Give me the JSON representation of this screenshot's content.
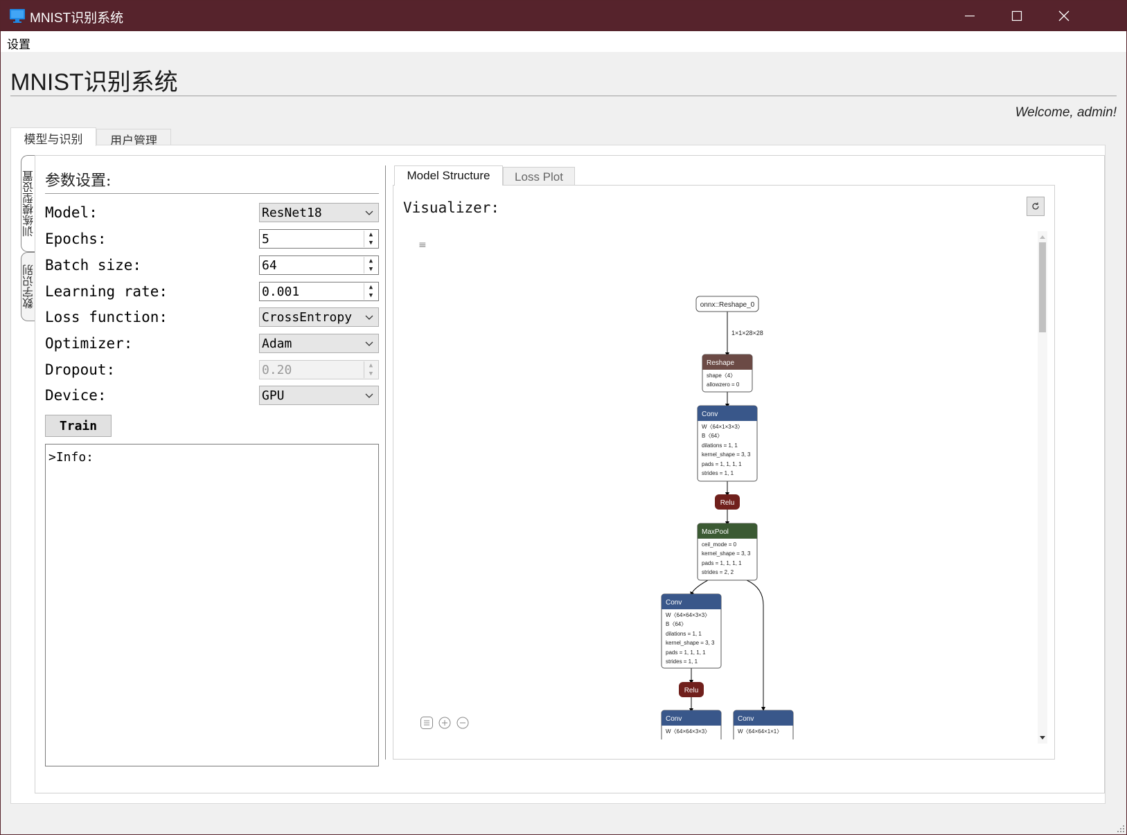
{
  "window": {
    "title": "MNIST识别系统"
  },
  "menu": {
    "settings": "设置"
  },
  "header": {
    "app_title": "MNIST识别系统",
    "welcome": "Welcome, admin!"
  },
  "main_tabs": [
    {
      "label": "模型与识别"
    },
    {
      "label": "用户管理"
    }
  ],
  "side_tabs": [
    {
      "label": "训练模型设置"
    },
    {
      "label": "数字识别"
    }
  ],
  "params": {
    "title": "参数设置:",
    "model": {
      "label": "Model:",
      "value": "ResNet18"
    },
    "epochs": {
      "label": "Epochs:",
      "value": "5"
    },
    "batch_size": {
      "label": "Batch size:",
      "value": "64"
    },
    "learning_rate": {
      "label": "Learning rate:",
      "value": "0.001"
    },
    "loss_function": {
      "label": "Loss function:",
      "value": "CrossEntropy"
    },
    "optimizer": {
      "label": "Optimizer:",
      "value": "Adam"
    },
    "dropout": {
      "label": "Dropout:",
      "value": "0.20"
    },
    "device": {
      "label": "Device:",
      "value": "GPU"
    },
    "train_button": "Train",
    "info_text": ">Info:"
  },
  "right_tabs": [
    {
      "label": "Model Structure"
    },
    {
      "label": "Loss Plot"
    }
  ],
  "visualizer": {
    "label": "Visualizer:",
    "nodes": {
      "input": "onnx::Reshape_0",
      "edge_label": "1×1×28×28",
      "reshape": {
        "title": "Reshape",
        "attrs": [
          "shape〈4〉",
          "allowzero = 0"
        ]
      },
      "conv1": {
        "title": "Conv",
        "attrs": [
          "W〈64×1×3×3〉",
          "B〈64〉",
          "dilations = 1, 1",
          "kernel_shape = 3, 3",
          "pads = 1, 1, 1, 1",
          "strides = 1, 1"
        ]
      },
      "relu1": "Relu",
      "maxpool": {
        "title": "MaxPool",
        "attrs": [
          "ceil_mode = 0",
          "kernel_shape = 3, 3",
          "pads = 1, 1, 1, 1",
          "strides = 2, 2"
        ]
      },
      "conv2": {
        "title": "Conv",
        "attrs": [
          "W〈64×64×3×3〉",
          "B〈64〉",
          "dilations = 1, 1",
          "kernel_shape = 3, 3",
          "pads = 1, 1, 1, 1",
          "strides = 1, 1"
        ]
      },
      "relu2": "Relu",
      "conv3": {
        "title": "Conv",
        "attrs": [
          "W〈64×64×3×3〉"
        ]
      },
      "conv4": {
        "title": "Conv",
        "attrs": [
          "W〈64×64×1×1〉"
        ]
      }
    }
  },
  "colors": {
    "titlebar": "#56232c",
    "conv": "#39578a",
    "reshape": "#6b4a45",
    "relu": "#70201c",
    "maxpool": "#3b5a33"
  }
}
